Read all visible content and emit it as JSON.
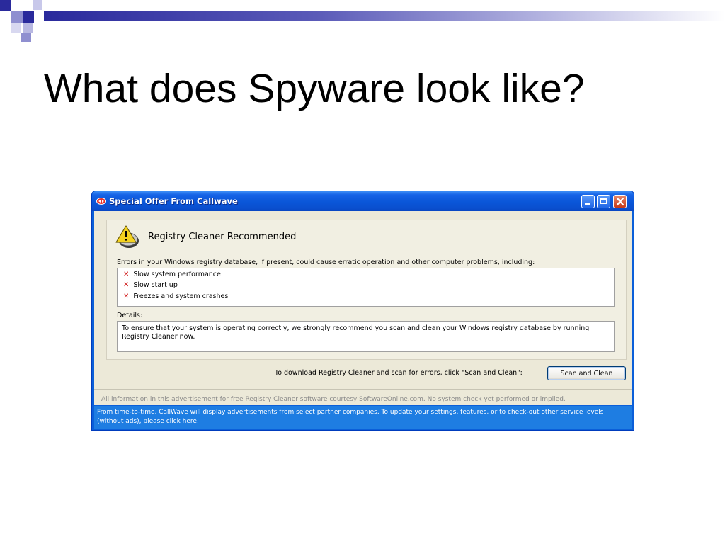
{
  "slide": {
    "title": "What does Spyware look like?"
  },
  "window": {
    "title": "Special Offer From Callwave",
    "icon": "callwave-icon",
    "controls": [
      "minimize-icon",
      "maximize-icon",
      "close-icon"
    ]
  },
  "dialog": {
    "heading": "Registry Cleaner Recommended",
    "heading_icon": "warning-icon",
    "intro": "Errors in your Windows registry database, if present, could cause erratic operation and other computer problems, including:",
    "issues": [
      "Slow system performance",
      "Slow start up",
      "Freezes and system crashes"
    ],
    "issue_icon": "red-x-icon",
    "details_label": "Details:",
    "details_text": "To ensure that your system is operating correctly, we strongly recommend you scan and clean your Windows registry database by running Registry Cleaner now.",
    "cta_text": "To download Registry Cleaner and scan for errors, click \"Scan and Clean\":",
    "scan_button": "Scan and Clean"
  },
  "disclaimer": "All information in this advertisement for free Registry Cleaner software courtesy SoftwareOnline.com.  No system check yet performed or implied.",
  "footer": "From time-to-time, CallWave will display advertisements from select partner companies. To update your settings, features, or to check-out other service levels (without ads), please click here.",
  "colors": {
    "titlebar": "#0a56d8",
    "client_bg": "#ece9d8",
    "footer_bg": "#1e7de2",
    "deco_dark": "#2a2a9c",
    "deco_light": "#b8b8e2"
  }
}
